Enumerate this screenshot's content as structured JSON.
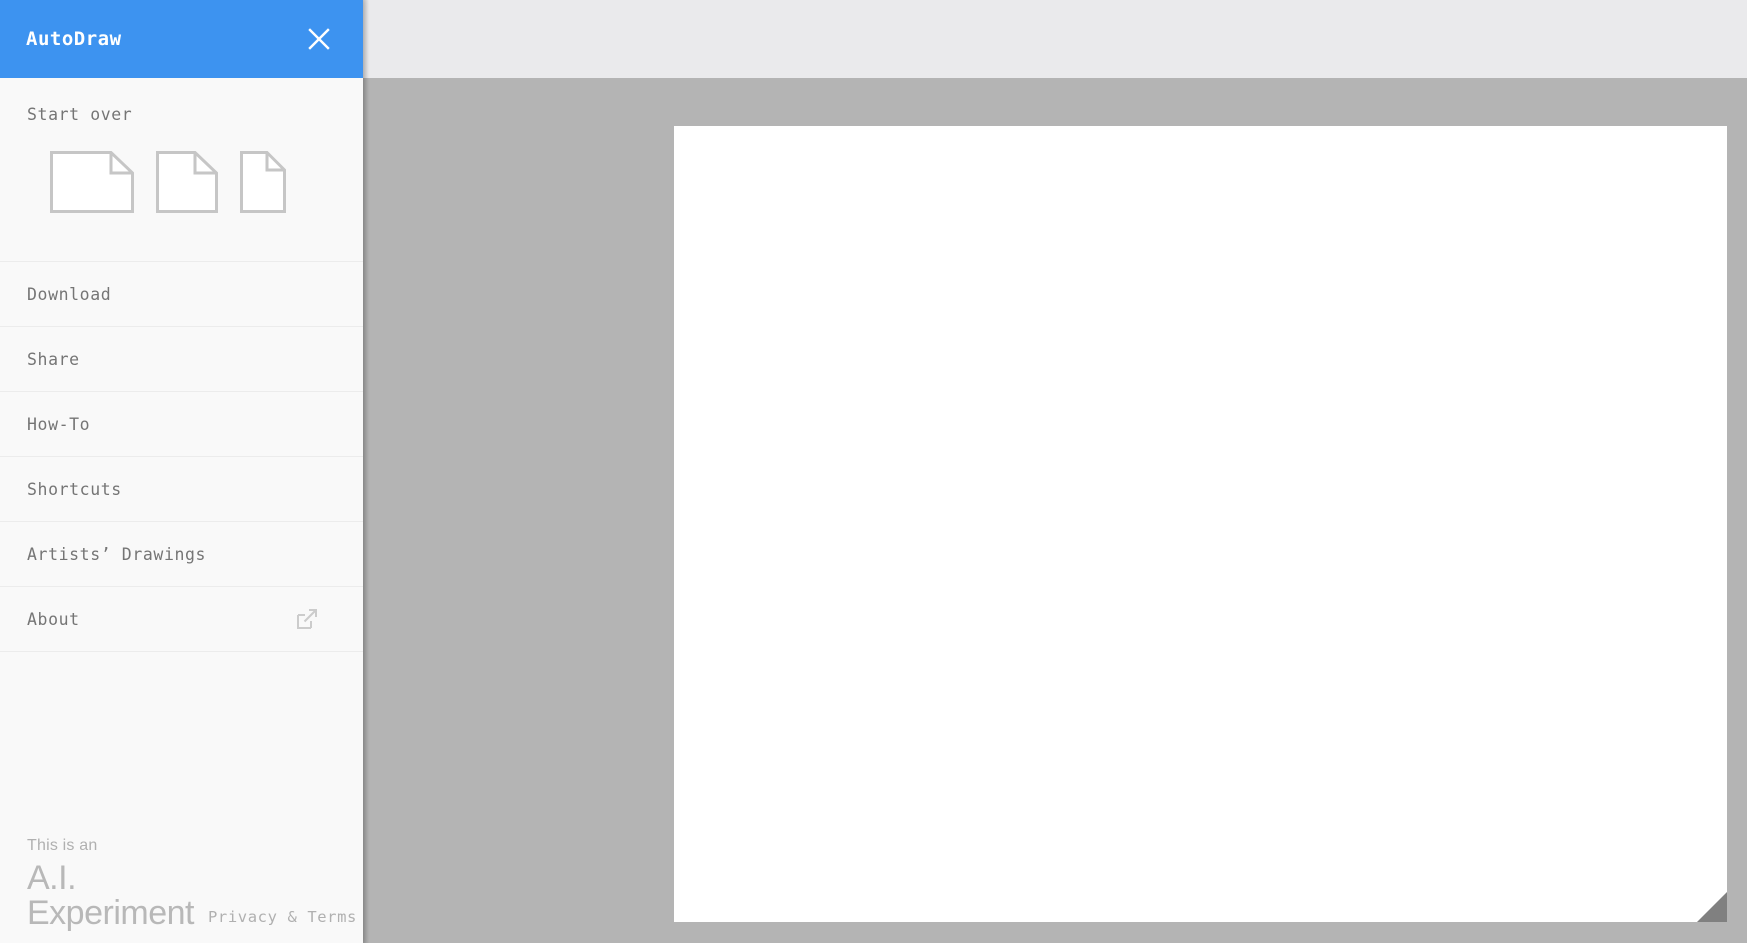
{
  "app": {
    "title": "AutoDraw",
    "accent_color": "#3d93f0",
    "sidebar_bg": "#f9f9f9",
    "text_color": "#757575",
    "workspace_bg": "#b4b4b4",
    "toolbar_bg": "#eaeaec",
    "canvas_bg": "#ffffff",
    "resize_handle_color": "#808080"
  },
  "sidebar": {
    "header": {
      "title": "AutoDraw",
      "close_icon": "close-icon"
    },
    "start_over": {
      "label": "Start over",
      "formats": [
        {
          "name": "landscape",
          "icon": "page-landscape-icon"
        },
        {
          "name": "square",
          "icon": "page-square-icon"
        },
        {
          "name": "portrait",
          "icon": "page-portrait-icon"
        }
      ]
    },
    "menu_items": [
      {
        "label": "Download",
        "icon": null
      },
      {
        "label": "Share",
        "icon": null
      },
      {
        "label": "How-To",
        "icon": null
      },
      {
        "label": "Shortcuts",
        "icon": null
      },
      {
        "label": "Artists’ Drawings",
        "icon": null
      },
      {
        "label": "About",
        "icon": "external-link-icon"
      }
    ],
    "footer": {
      "tagline": "This is an",
      "brand_line1": "A.I.",
      "brand_line2": "Experiment",
      "privacy_terms": "Privacy & Terms"
    }
  },
  "workspace": {
    "canvas": {
      "name": "drawing-canvas",
      "resize_handle": "canvas-resize-handle"
    }
  }
}
